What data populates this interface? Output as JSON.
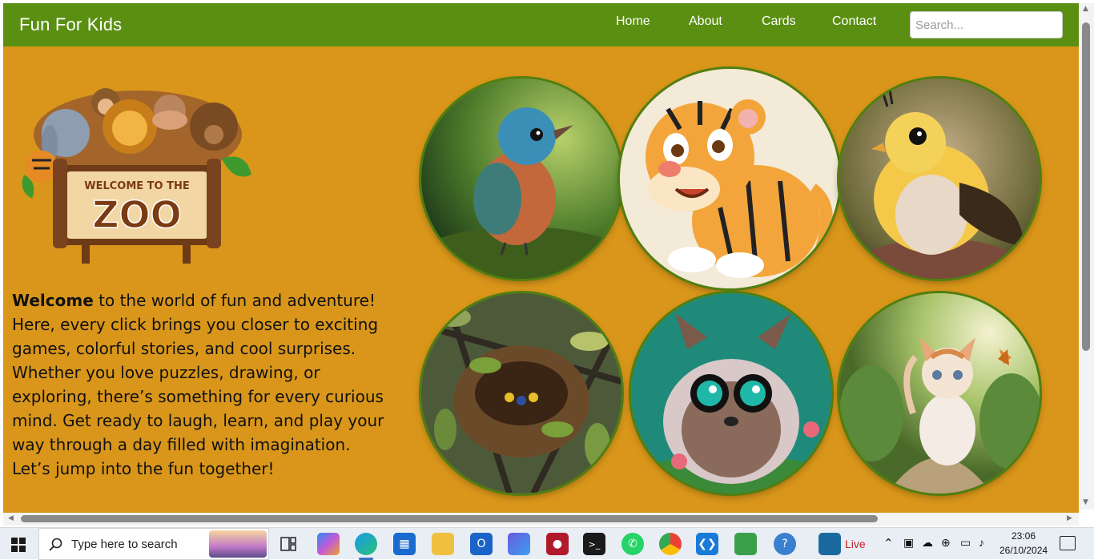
{
  "nav": {
    "brand": "Fun For Kids",
    "links": [
      "Home",
      "About",
      "Cards",
      "Contact"
    ],
    "search_placeholder": "Search..."
  },
  "logo": {
    "sign_top": "WELCOME TO THE",
    "sign_main": "ZOO"
  },
  "intro": {
    "bold": "Welcome",
    "text": " to the world of fun and adventure! Here, every click brings you closer to exciting games, colorful stories, and cool surprises. Whether you love puzzles, drawing, or exploring, there’s something for every curious mind. Get ready to laugh, learn, and play your way through a day filled with imagination. Let’s jump into the fun together!"
  },
  "gallery": [
    "bird-1",
    "tiger",
    "bird-2",
    "nest",
    "hedgehog",
    "kitten"
  ],
  "colors": {
    "navbar": "#5a8f12",
    "page_background": "#d9961a",
    "circle_border": "#4f7f10"
  },
  "taskbar": {
    "search_placeholder": "Type here to search",
    "live_label": "Live",
    "time": "23:06",
    "date": "26/10/2024"
  }
}
